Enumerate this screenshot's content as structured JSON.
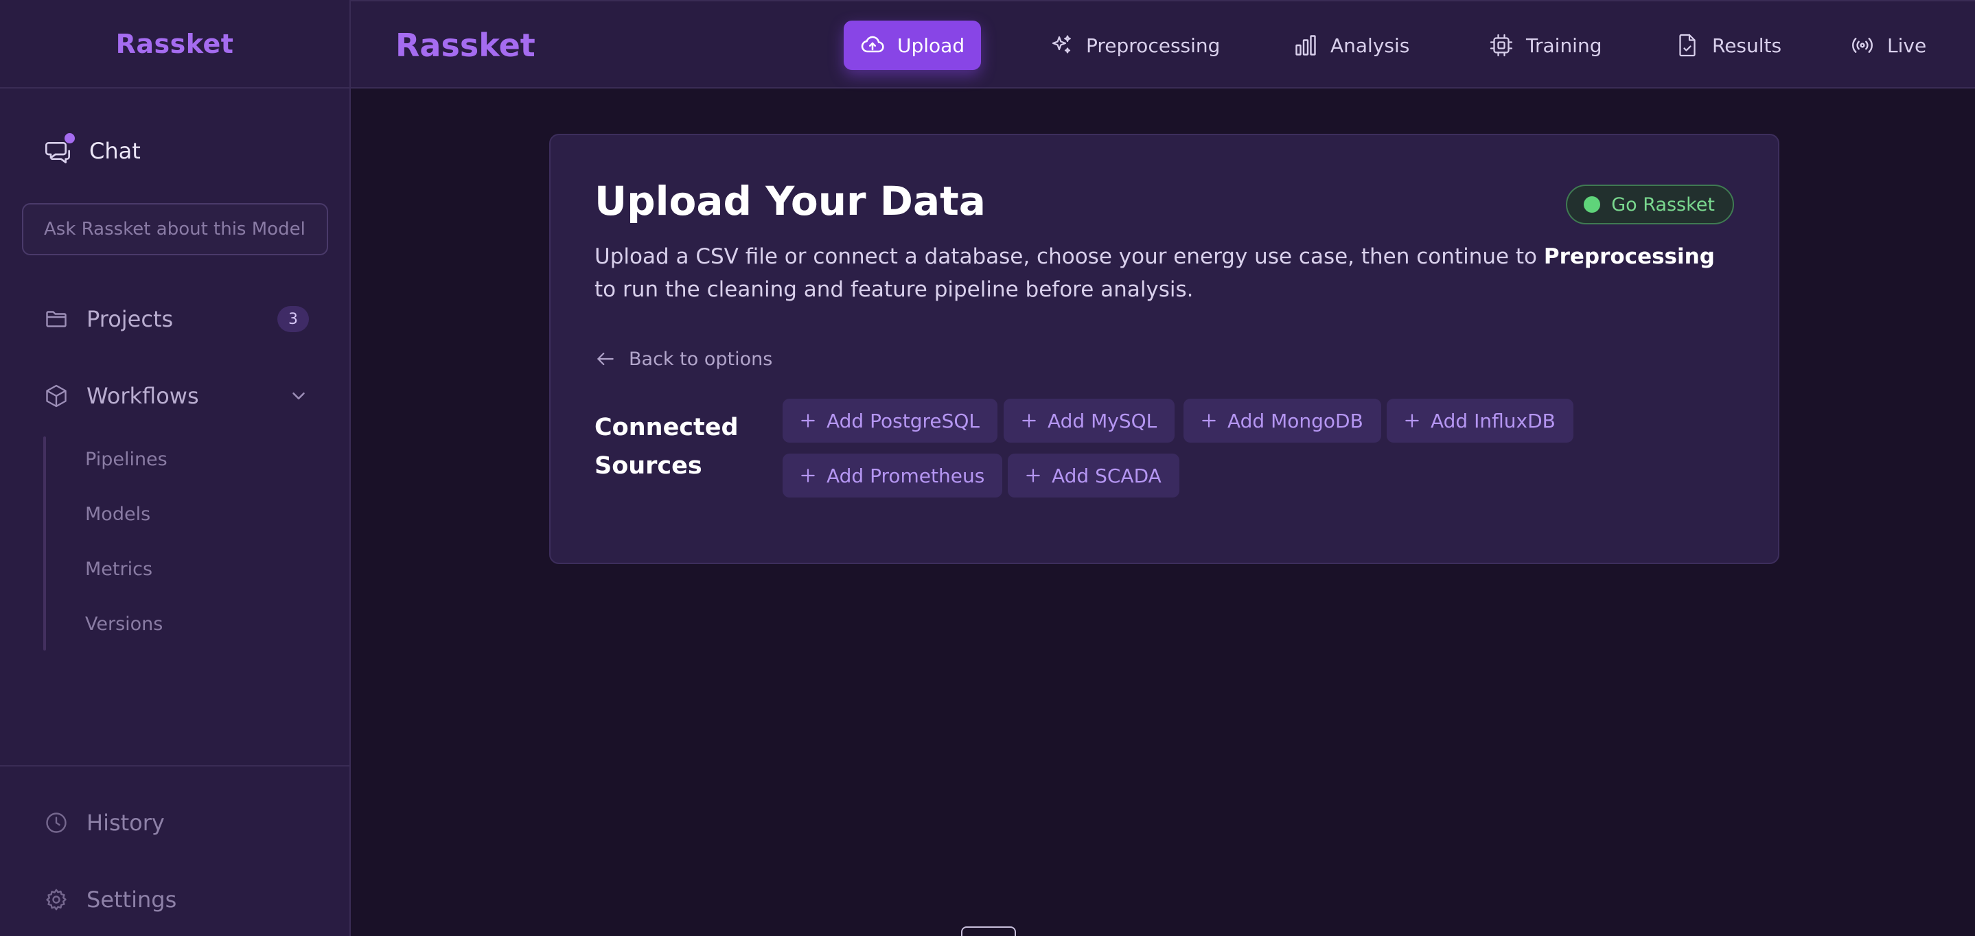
{
  "sidebar": {
    "brand": "Rassket",
    "chat": {
      "label": "Chat",
      "icon": "chat-icon"
    },
    "ask_placeholder": "Ask Rassket about this Model",
    "projects": {
      "label": "Projects",
      "count": "3",
      "icon": "folder-icon"
    },
    "workflows": {
      "label": "Workflows",
      "icon": "cube-icon",
      "expanded": true,
      "items": [
        "Pipelines",
        "Models",
        "Metrics",
        "Versions"
      ]
    },
    "history": {
      "label": "History",
      "icon": "clock-icon"
    },
    "settings": {
      "label": "Settings",
      "icon": "gear-icon"
    }
  },
  "topbar": {
    "brand": "Rassket",
    "nav": [
      {
        "label": "Upload",
        "icon": "cloud-upload-icon",
        "active": true
      },
      {
        "label": "Preprocessing",
        "icon": "sparkles-icon",
        "active": false
      },
      {
        "label": "Analysis",
        "icon": "bar-chart-icon",
        "active": false
      },
      {
        "label": "Training",
        "icon": "cpu-chip-icon",
        "active": false
      },
      {
        "label": "Results",
        "icon": "file-check-icon",
        "active": false
      },
      {
        "label": "Live",
        "icon": "broadcast-icon",
        "active": false
      }
    ]
  },
  "main": {
    "title": "Upload Your Data",
    "status": "Go Rassket",
    "description_before": "Upload a CSV file or connect a database, choose your energy use case, then continue to ",
    "description_bold": "Preprocessing",
    "description_after": " to run the cleaning and feature pipeline before analysis.",
    "back_link": "Back to options",
    "sources_label": "Connected Sources",
    "sources": [
      "Add PostgreSQL",
      "Add MySQL",
      "Add MongoDB",
      "Add InfluxDB",
      "Add Prometheus",
      "Add SCADA"
    ]
  },
  "colors": {
    "accent": "#a56cf0",
    "active_nav": "#8845e6",
    "status_green": "#5fd47a",
    "background": "#1a1128",
    "panel": "#291c42"
  }
}
